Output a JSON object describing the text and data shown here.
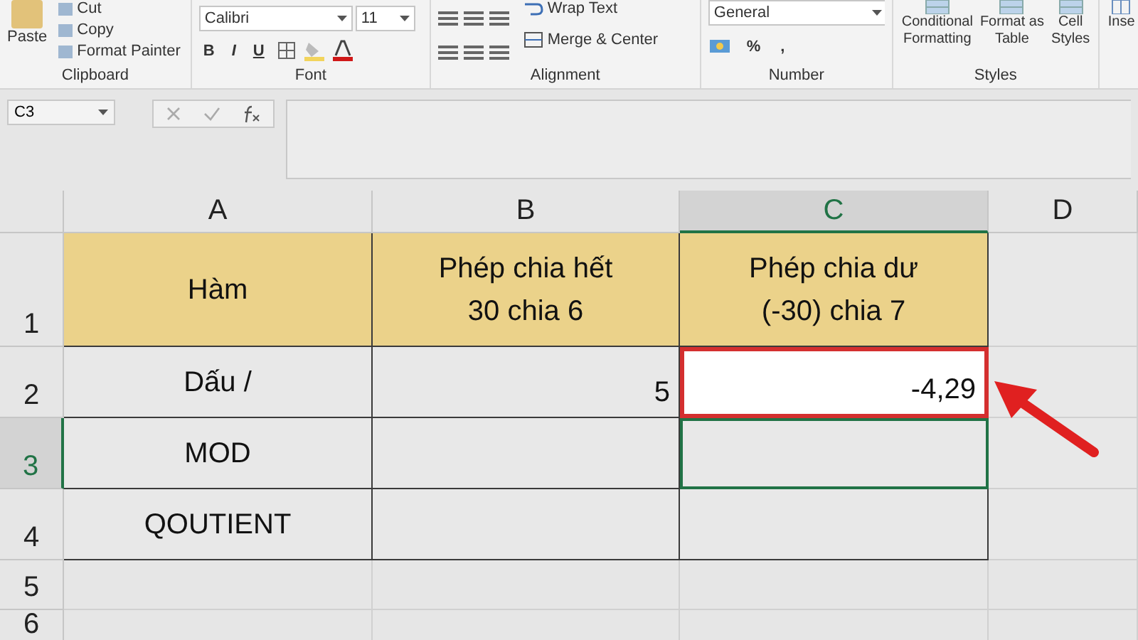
{
  "ribbon": {
    "groups": [
      {
        "kind": "clipboard",
        "label": "Clipboard",
        "paste": "Paste",
        "items": [
          "Cut",
          "Copy",
          "Format Painter"
        ]
      },
      {
        "kind": "font",
        "label": "Font",
        "font_name": "Calibri",
        "font_size": "11",
        "styles": [
          "B",
          "I",
          "U"
        ]
      },
      {
        "kind": "alignment",
        "label": "Alignment",
        "wrap": "Wrap Text",
        "merge": "Merge & Center"
      },
      {
        "kind": "number",
        "label": "Number",
        "format": "General",
        "symbols": [
          "%",
          ","
        ]
      },
      {
        "kind": "styles",
        "label": "Styles",
        "buttons": [
          [
            "Conditional",
            "Formatting"
          ],
          [
            "Format as",
            "Table"
          ],
          [
            "Cell",
            "Styles"
          ]
        ]
      },
      {
        "kind": "cells",
        "buttons": [
          "Inse"
        ]
      }
    ]
  },
  "name_box": "C3",
  "columns": [
    {
      "label": "A",
      "selected": false
    },
    {
      "label": "B",
      "selected": false
    },
    {
      "label": "C",
      "selected": true
    },
    {
      "label": "D",
      "selected": false
    }
  ],
  "rows": [
    {
      "header": "1",
      "selected": false,
      "cells": [
        {
          "lines": [
            "Hàm"
          ],
          "kind": "heading",
          "selected": false,
          "marked": false
        },
        {
          "lines": [
            "Phép chia hết",
            "30 chia 6"
          ],
          "kind": "heading",
          "selected": false,
          "marked": false
        },
        {
          "lines": [
            "Phép chia dư",
            "(-30) chia 7"
          ],
          "kind": "heading",
          "selected": false,
          "marked": false
        },
        {
          "kind": "plain",
          "selected": false,
          "marked": false
        }
      ]
    },
    {
      "header": "2",
      "selected": false,
      "cells": [
        {
          "lines": [
            "Dấu /"
          ],
          "kind": "label",
          "selected": false,
          "marked": false
        },
        {
          "lines": [
            "5"
          ],
          "kind": "number",
          "selected": false,
          "marked": false
        },
        {
          "lines": [
            "-4,29"
          ],
          "kind": "number",
          "selected": false,
          "marked": true
        },
        {
          "kind": "plain",
          "selected": false,
          "marked": false
        }
      ]
    },
    {
      "header": "3",
      "selected": true,
      "cells": [
        {
          "lines": [
            "MOD"
          ],
          "kind": "label",
          "selected": false,
          "marked": false
        },
        {
          "kind": "number",
          "selected": false,
          "marked": false
        },
        {
          "kind": "number",
          "selected": true,
          "marked": false
        },
        {
          "kind": "plain",
          "selected": false,
          "marked": false
        }
      ]
    },
    {
      "header": "4",
      "selected": false,
      "cells": [
        {
          "lines": [
            "QOUTIENT"
          ],
          "kind": "label",
          "selected": false,
          "marked": false
        },
        {
          "kind": "number",
          "selected": false,
          "marked": false
        },
        {
          "kind": "number",
          "selected": false,
          "marked": false
        },
        {
          "kind": "plain",
          "selected": false,
          "marked": false
        }
      ]
    },
    {
      "header": "5",
      "selected": false,
      "cells": []
    },
    {
      "header": "6",
      "selected": false,
      "cells": []
    }
  ]
}
